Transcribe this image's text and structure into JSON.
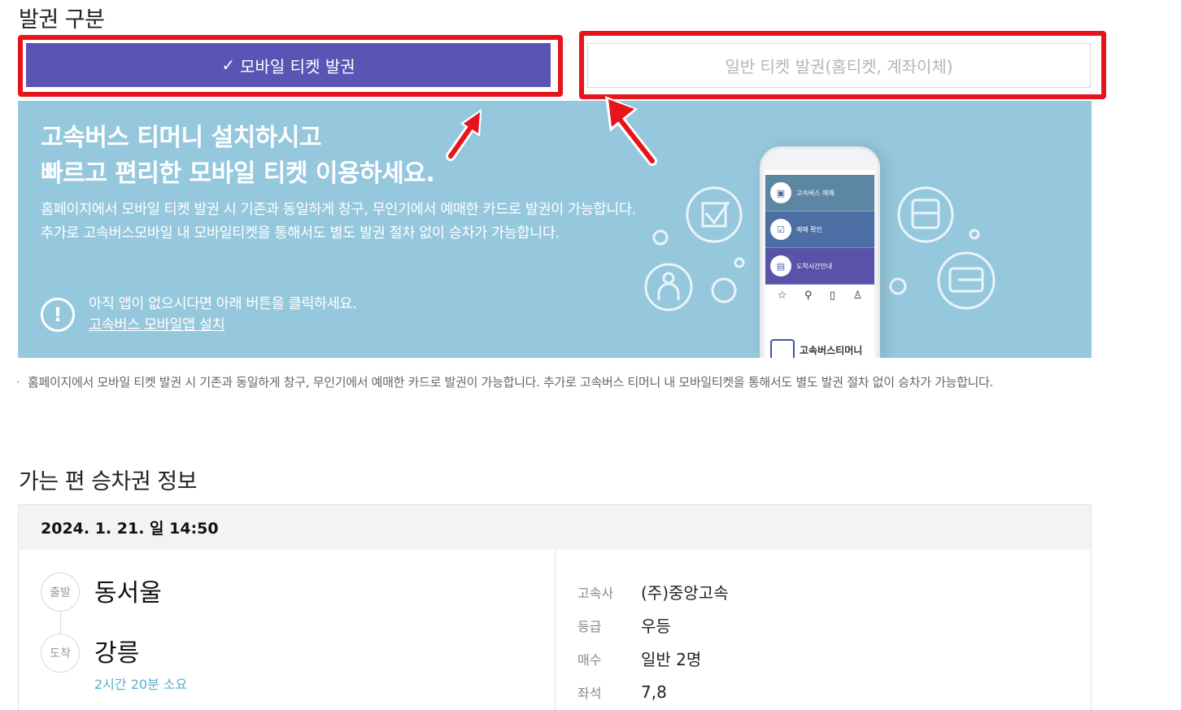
{
  "issue_section": {
    "title": "발권 구분",
    "tab_mobile_check": "✓",
    "tab_mobile": "모바일 티켓 발권",
    "tab_general": "일반 티켓 발권(홈티켓, 계좌이체)"
  },
  "banner": {
    "headline_1": "고속버스 티머니 설치하시고",
    "headline_2": "빠르고 편리한 모바일 티켓 이용하세요.",
    "body": "홈페이지에서 모바일 티켓 발권 시 기존과 동일하게 창구, 무인기에서 예매한 카드로 발권이 가능합니다. 추가로 고속버스모바일 내 모바일티켓을 통해서도 별도 발권 절차 없이 승차가 가능합니다.",
    "notice_icon": "!",
    "notice": "아직 앱이 없으시다면 아래 버튼을 클릭하세요.",
    "install_link": "고속버스 모바일앱 설치",
    "phone_menu": [
      "고속버스 예매",
      "예매 확인",
      "도착시간안내"
    ],
    "phone_brand": "고속버스티머니"
  },
  "note": "홈페이지에서 모바일 티켓 발권 시 기존과 동일하게 창구, 무인기에서 예매한 카드로 발권이 가능합니다. 추가로 고속버스 티머니 내 모바일티켓을 통해서도 별도 발권 절차 없이 승차가 가능합니다.",
  "ticket_section": {
    "title": "가는 편 승차권 정보",
    "datetime": "2024. 1. 21. 일 14:50",
    "depart_badge": "출발",
    "depart": "동서울",
    "arrive_badge": "도착",
    "arrive": "강릉",
    "duration": "2시간 20분 소요",
    "info": [
      {
        "label": "고속사",
        "value": "(주)중앙고속"
      },
      {
        "label": "등급",
        "value": "우등"
      },
      {
        "label": "매수",
        "value": "일반 2명"
      },
      {
        "label": "좌석",
        "value": "7,8"
      }
    ]
  },
  "colors": {
    "tab_active": "#5a54b5",
    "banner_bg": "#96c8dd",
    "highlight": "#e8141b",
    "duration_text": "#5aaed0"
  }
}
